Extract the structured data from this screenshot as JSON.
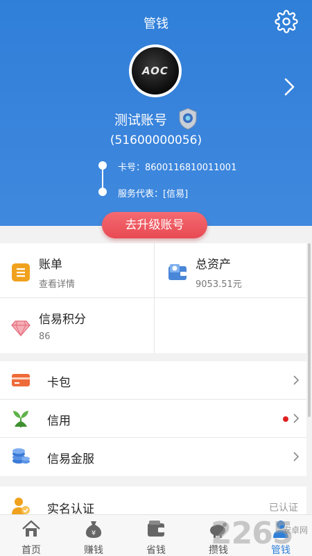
{
  "header": {
    "title": "管钱",
    "avatar_text": "AOC",
    "account_name": "测试账号",
    "phone": "(51600000056)",
    "card_label": "卡号：8600116810011001",
    "rep_label": "服务代表：[信易]",
    "upgrade_label": "去升级账号"
  },
  "grid": {
    "bill": {
      "label": "账单",
      "sub": "查看详情"
    },
    "assets": {
      "label": "总资产",
      "sub": "9053.51元"
    },
    "points": {
      "label": "信易积分",
      "sub": "86"
    }
  },
  "list": {
    "items": [
      {
        "label": "卡包"
      },
      {
        "label": "信用"
      },
      {
        "label": "信易金服"
      }
    ]
  },
  "verify": {
    "label": "实名认证",
    "status": "已认证"
  },
  "tabs": [
    {
      "label": "首页"
    },
    {
      "label": "赚钱"
    },
    {
      "label": "省钱"
    },
    {
      "label": "攒钱"
    },
    {
      "label": "管钱"
    }
  ],
  "watermark": {
    "big": "2265",
    "small": "安卓网"
  },
  "colors": {
    "accent": "#2f7fd8",
    "upgrade": "#e84a53",
    "notify_dot": "#e02020"
  }
}
